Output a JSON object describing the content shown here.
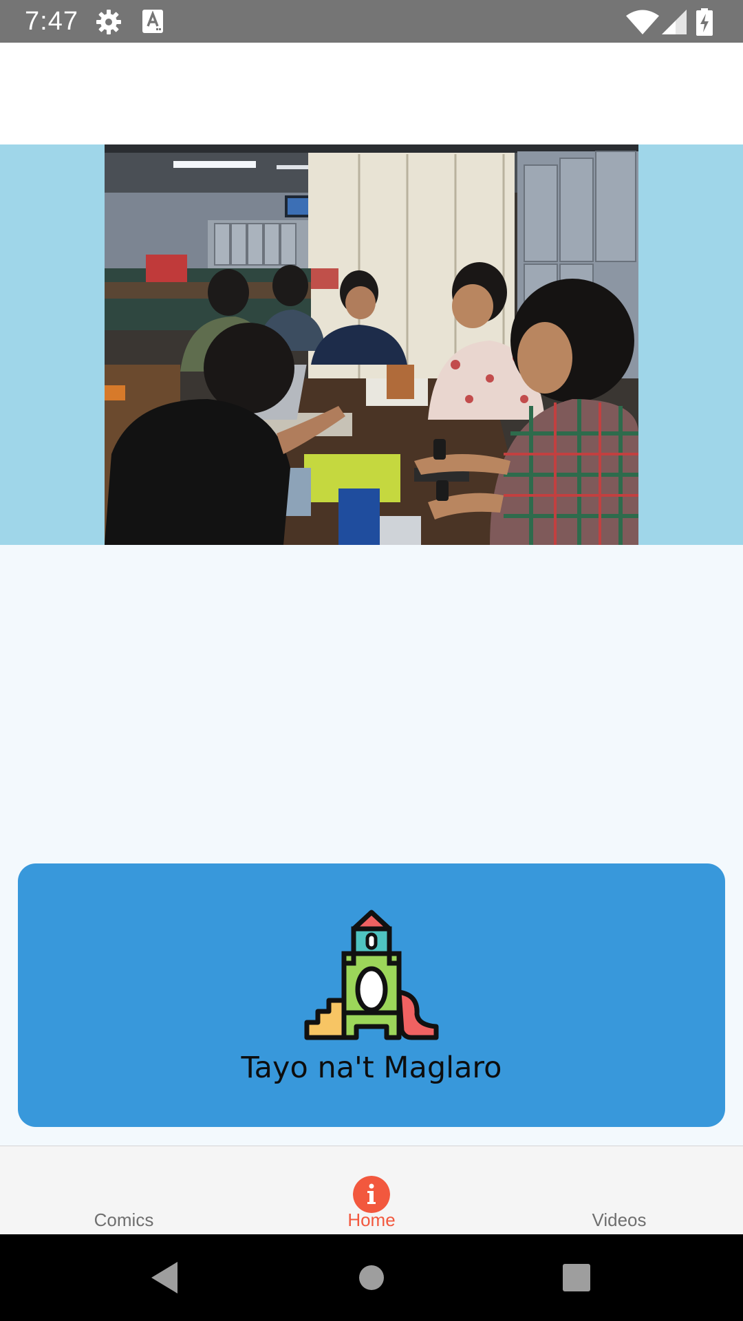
{
  "status_bar": {
    "time": "7:47",
    "icons": [
      "gear-icon",
      "keyboard-a-icon",
      "wifi-icon",
      "signal-icon",
      "battery-charging-icon"
    ]
  },
  "banner": {
    "image_alt": "Group of people working around a table with laptops",
    "band_color": "#9fd6e9"
  },
  "game_card": {
    "title": "Tayo na't Maglaro",
    "icon": "playground-tower-icon",
    "background": "#3898db"
  },
  "bottom_nav": {
    "items": [
      {
        "label": "Comics",
        "active": false
      },
      {
        "label": "Home",
        "active": true,
        "icon": "info-icon"
      },
      {
        "label": "Videos",
        "active": false
      }
    ],
    "active_color": "#f2583e"
  },
  "system_nav": {
    "buttons": [
      "back-icon",
      "home-circle-icon",
      "recents-square-icon"
    ]
  }
}
